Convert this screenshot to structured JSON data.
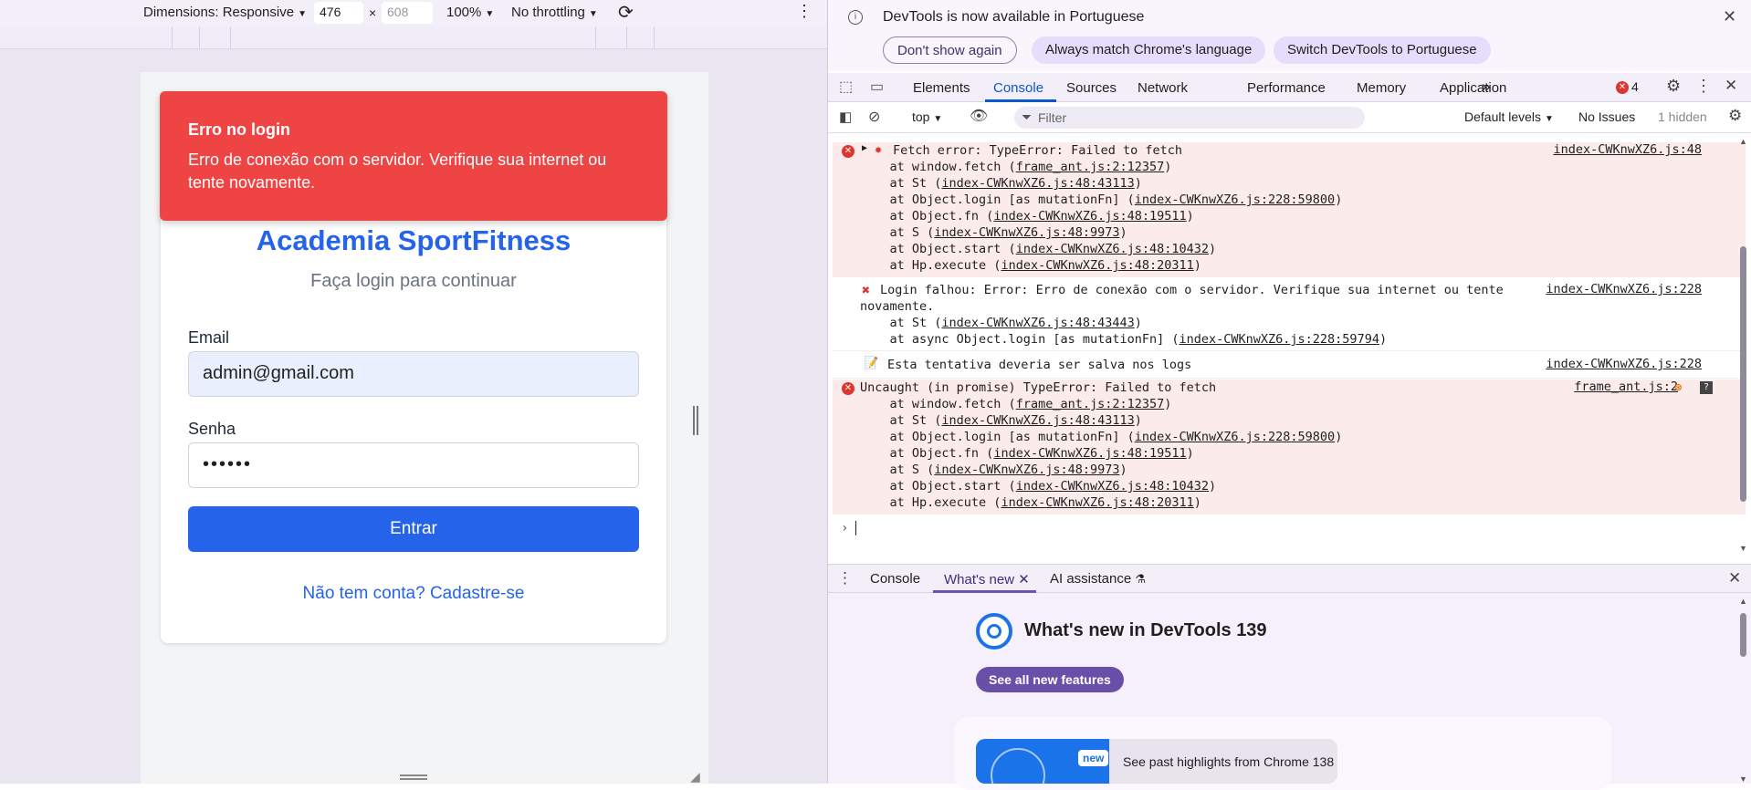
{
  "device_toolbar": {
    "dimensions_label": "Dimensions: Responsive",
    "width_value": "476",
    "times": "×",
    "height_value": "608",
    "zoom": "100%",
    "throttling": "No throttling"
  },
  "app": {
    "toast_title": "Erro no login",
    "toast_message": "Erro de conexão com o servidor. Verifique sua internet ou tente novamente.",
    "title": "Academia SportFitness",
    "subtitle": "Faça login para continuar",
    "email_label": "Email",
    "email_value": "admin@gmail.com",
    "password_label": "Senha",
    "password_value": "••••••",
    "login_button": "Entrar",
    "signup_link": "Não tem conta? Cadastre-se",
    "colors": {
      "primary": "#2563eb",
      "toast": "#ef4444"
    }
  },
  "banner": {
    "text": "DevTools is now available in Portuguese",
    "dont_show": "Don't show again",
    "always_match": "Always match Chrome's language",
    "switch": "Switch DevTools to Portuguese"
  },
  "tabs": {
    "elements": "Elements",
    "console": "Console",
    "sources": "Sources",
    "network": "Network",
    "performance": "Performance",
    "memory": "Memory",
    "application": "Application",
    "error_count": "4"
  },
  "console_toolbar": {
    "context": "top",
    "filter_placeholder": "Filter",
    "levels": "Default levels",
    "issues": "No Issues",
    "hidden": "1 hidden"
  },
  "messages": {
    "m1": {
      "title": "Fetch error: TypeError: Failed to fetch",
      "source": "index-CWKnwXZ6.js:48",
      "stack": [
        {
          "pre": "    at window.fetch (",
          "link": "frame_ant.js:2:12357",
          "post": ")"
        },
        {
          "pre": "    at St (",
          "link": "index-CWKnwXZ6.js:48:43113",
          "post": ")"
        },
        {
          "pre": "    at Object.login [as mutationFn] (",
          "link": "index-CWKnwXZ6.js:228:59800",
          "post": ")"
        },
        {
          "pre": "    at Object.fn (",
          "link": "index-CWKnwXZ6.js:48:19511",
          "post": ")"
        },
        {
          "pre": "    at S (",
          "link": "index-CWKnwXZ6.js:48:9973",
          "post": ")"
        },
        {
          "pre": "    at Object.start (",
          "link": "index-CWKnwXZ6.js:48:10432",
          "post": ")"
        },
        {
          "pre": "    at Hp.execute (",
          "link": "index-CWKnwXZ6.js:48:20311",
          "post": ")"
        }
      ]
    },
    "m2": {
      "line1": "Login falhou: Error: Erro de conexão com o servidor. Verifique sua internet ou tente",
      "line2": "novamente.",
      "source": "index-CWKnwXZ6.js:228",
      "stack": [
        {
          "pre": "    at St (",
          "link": "index-CWKnwXZ6.js:48:43443",
          "post": ")"
        },
        {
          "pre": "    at async Object.login [as mutationFn] (",
          "link": "index-CWKnwXZ6.js:228:59794",
          "post": ")"
        }
      ]
    },
    "m3": {
      "text": "Esta tentativa deveria ser salva nos logs",
      "source": "index-CWKnwXZ6.js:228"
    },
    "m4": {
      "title": "Uncaught (in promise) TypeError: Failed to fetch",
      "source": "frame_ant.js:2",
      "stack": [
        {
          "pre": "    at window.fetch (",
          "link": "frame_ant.js:2:12357",
          "post": ")"
        },
        {
          "pre": "    at St (",
          "link": "index-CWKnwXZ6.js:48:43113",
          "post": ")"
        },
        {
          "pre": "    at Object.login [as mutationFn] (",
          "link": "index-CWKnwXZ6.js:228:59800",
          "post": ")"
        },
        {
          "pre": "    at Object.fn (",
          "link": "index-CWKnwXZ6.js:48:19511",
          "post": ")"
        },
        {
          "pre": "    at S (",
          "link": "index-CWKnwXZ6.js:48:9973",
          "post": ")"
        },
        {
          "pre": "    at Object.start (",
          "link": "index-CWKnwXZ6.js:48:10432",
          "post": ")"
        },
        {
          "pre": "    at Hp.execute (",
          "link": "index-CWKnwXZ6.js:48:20311",
          "post": ")"
        }
      ]
    }
  },
  "drawer": {
    "console": "Console",
    "whats_new": "What's new",
    "ai": "AI assistance"
  },
  "whats_new": {
    "heading": "What's new in DevTools 139",
    "see_all": "See all new features",
    "badge": "new",
    "highlight": "See past highlights from Chrome 138"
  }
}
